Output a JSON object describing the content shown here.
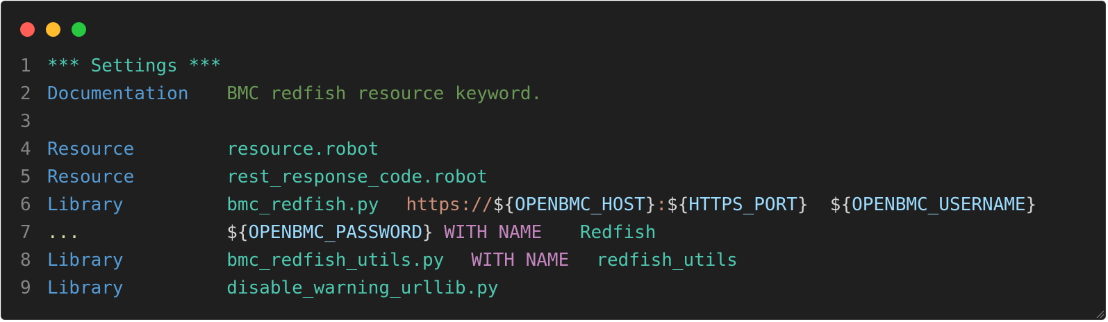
{
  "window": {
    "controls": [
      {
        "name": "close-button",
        "color": "#ff5f57"
      },
      {
        "name": "minimize-button",
        "color": "#febc2e"
      },
      {
        "name": "zoom-button",
        "color": "#28c840"
      }
    ]
  },
  "colors": {
    "section_header": "#4ec9b0",
    "setting_keyword": "#569cd6",
    "documentation_text": "#6a9955",
    "value": "#4ec9b0",
    "url_scheme": "#ce9178",
    "variable": "#9cdcfe",
    "variable_brace": "#d4d4d4",
    "with_name": "#c586c0",
    "continuation": "#dcdcaa"
  },
  "code": {
    "lines": [
      {
        "number": "1",
        "tokens": [
          {
            "text": "*** Settings ***",
            "kind": "section_header"
          }
        ]
      },
      {
        "number": "2",
        "tokens": [
          {
            "text": "Documentation",
            "kind": "setting_keyword"
          },
          {
            "text": "BMC redfish resource keyword.",
            "kind": "documentation_text"
          }
        ]
      },
      {
        "number": "3",
        "tokens": []
      },
      {
        "number": "4",
        "tokens": [
          {
            "text": "Resource",
            "kind": "setting_keyword"
          },
          {
            "text": "resource.robot",
            "kind": "value"
          }
        ]
      },
      {
        "number": "5",
        "tokens": [
          {
            "text": "Resource",
            "kind": "setting_keyword"
          },
          {
            "text": "rest_response_code.robot",
            "kind": "value"
          }
        ]
      },
      {
        "number": "6",
        "tokens": [
          {
            "text": "Library",
            "kind": "setting_keyword"
          },
          {
            "text": "bmc_redfish.py",
            "kind": "value"
          },
          {
            "text": "https://",
            "kind": "url_scheme"
          },
          {
            "text": "${",
            "kind": "variable_brace"
          },
          {
            "text": "OPENBMC_HOST",
            "kind": "variable"
          },
          {
            "text": "}",
            "kind": "variable_brace"
          },
          {
            "text": ":",
            "kind": "url_scheme"
          },
          {
            "text": "${",
            "kind": "variable_brace"
          },
          {
            "text": "HTTPS_PORT",
            "kind": "variable"
          },
          {
            "text": "}",
            "kind": "variable_brace"
          },
          {
            "text": "${",
            "kind": "variable_brace"
          },
          {
            "text": "OPENBMC_USERNAME",
            "kind": "variable"
          },
          {
            "text": "}",
            "kind": "variable_brace"
          }
        ]
      },
      {
        "number": "7",
        "tokens": [
          {
            "text": "...",
            "kind": "continuation"
          },
          {
            "text": "${",
            "kind": "variable_brace"
          },
          {
            "text": "OPENBMC_PASSWORD",
            "kind": "variable"
          },
          {
            "text": "}",
            "kind": "variable_brace"
          },
          {
            "text": "WITH NAME",
            "kind": "with_name"
          },
          {
            "text": "Redfish",
            "kind": "value"
          }
        ]
      },
      {
        "number": "8",
        "tokens": [
          {
            "text": "Library",
            "kind": "setting_keyword"
          },
          {
            "text": "bmc_redfish_utils.py",
            "kind": "value"
          },
          {
            "text": "WITH NAME",
            "kind": "with_name"
          },
          {
            "text": "redfish_utils",
            "kind": "value"
          }
        ]
      },
      {
        "number": "9",
        "tokens": [
          {
            "text": "Library",
            "kind": "setting_keyword"
          },
          {
            "text": "disable_warning_urllib.py",
            "kind": "value"
          }
        ]
      }
    ]
  }
}
